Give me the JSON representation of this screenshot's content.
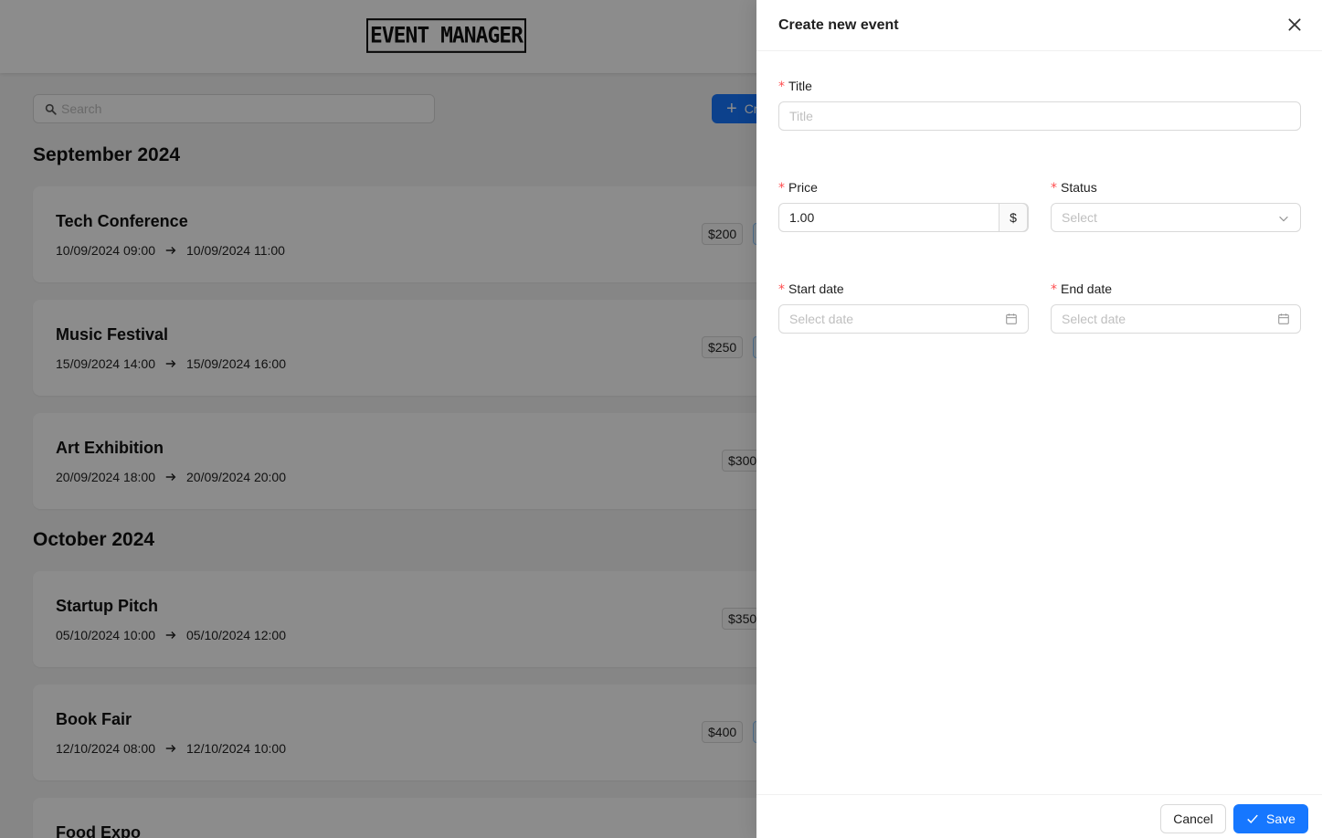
{
  "app": {
    "logo_text": "EVENT MANAGER",
    "search_placeholder": "Search",
    "create_button_label": "Create event",
    "months": [
      {
        "label": "September 2024",
        "events": [
          {
            "title": "Tech Conference",
            "start": "10/09/2024 09:00",
            "end": "10/09/2024 11:00",
            "price": "$200"
          },
          {
            "title": "Music Festival",
            "start": "15/09/2024 14:00",
            "end": "15/09/2024 16:00",
            "price": "$250"
          },
          {
            "title": "Art Exhibition",
            "start": "20/09/2024 18:00",
            "end": "20/09/2024 20:00",
            "price": "$300"
          }
        ]
      },
      {
        "label": "October 2024",
        "events": [
          {
            "title": "Startup Pitch",
            "start": "05/10/2024 10:00",
            "end": "05/10/2024 12:00",
            "price": "$350"
          },
          {
            "title": "Book Fair",
            "start": "12/10/2024 08:00",
            "end": "12/10/2024 10:00",
            "price": "$400"
          },
          {
            "title": "Food Expo",
            "start": "",
            "end": "",
            "price": ""
          }
        ]
      }
    ]
  },
  "drawer": {
    "title": "Create new event",
    "fields": {
      "title": {
        "label": "Title",
        "placeholder": "Title",
        "value": ""
      },
      "price": {
        "label": "Price",
        "value": "1.00",
        "addon": "$"
      },
      "status": {
        "label": "Status",
        "placeholder": "Select"
      },
      "start_date": {
        "label": "Start date",
        "placeholder": "Select date"
      },
      "end_date": {
        "label": "End date",
        "placeholder": "Select date"
      }
    },
    "footer": {
      "cancel_label": "Cancel",
      "save_label": "Save"
    }
  },
  "colors": {
    "primary": "#1677ff",
    "required": "#ff4d4f",
    "border": "#d9d9d9",
    "mask": "rgba(0,0,0,0.45)"
  }
}
